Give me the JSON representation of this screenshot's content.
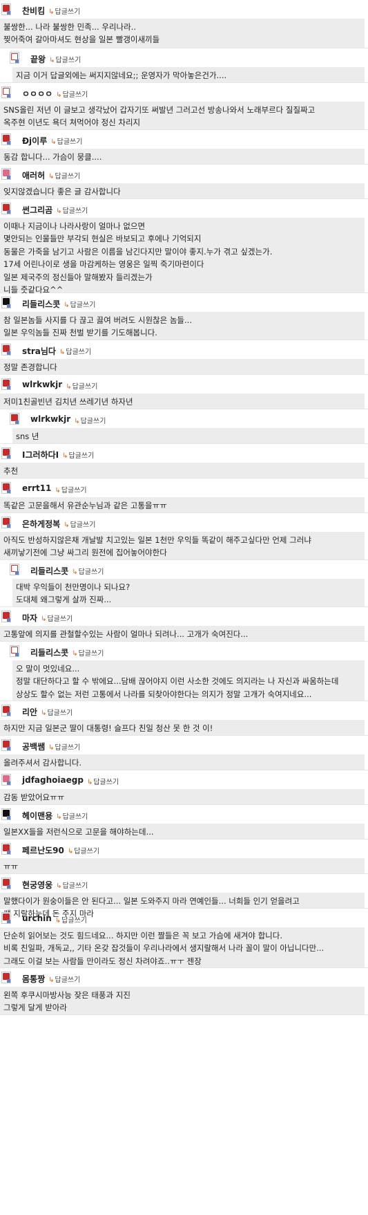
{
  "reply_label": "답글쓰기",
  "comments": [
    {
      "nick": "찬비킴",
      "avatar": "red",
      "nested": false,
      "body_height": 42,
      "lines": [
        "불쌍한... 나라 불쌍한 민족... 우리나라..",
        "찢어죽여 갈아마셔도 현상을 일본 빨갱이새끼들"
      ]
    },
    {
      "nick": "끝왕",
      "avatar": "plain",
      "nested": true,
      "body_height": 22,
      "lines": [
        "지금 이거 답글외에는 써지지않네요;; 운영자가 막아놓은건가...."
      ]
    },
    {
      "nick": "ㅇㅇㅇㅇ",
      "avatar": "plain",
      "nested": false,
      "body_height": 40,
      "lines": [
        "SNS올린 저년 이 글보고 생각났어 갑자기또 써발년 그러고선 방송나와서 노래부르다 질질짜고",
        "옥주현 이년도 욕더 쳐먹어야 정신 차리지"
      ]
    },
    {
      "nick": "Ðj이루",
      "avatar": "red",
      "nested": false,
      "body_height": 22,
      "lines": [
        "동감 합니다... 가슴이 뭉클...."
      ]
    },
    {
      "nick": "애러허",
      "avatar": "pink",
      "nested": false,
      "body_height": 22,
      "lines": [
        "잊지않겠습니다 좋은 글 감사합니다"
      ]
    },
    {
      "nick": "썬그리곰",
      "avatar": "red",
      "nested": false,
      "body_height": 108,
      "lines": [
        "이때나 지금이나 나라사랑이 얼마나 없으면",
        "몇안되는 인물들만 부각되 현실은 바보되고 후에나 기억되지",
        "동물은 가죽을 남기고 사람은 이름을 남긴다지만 말이야 좋지.누가 겪고 싶겠는가.",
        "17세 어린나이로 생을 마감케하는 영웅은 일찍 죽기마련이다",
        "일본 제국주의 정신들아 말해봤자 들리겠는가",
        "니들 줏같다요^^"
      ]
    },
    {
      "nick": "리들리스콧",
      "avatar": "black",
      "nested": false,
      "body_height": 40,
      "lines": [
        "참 일본놈들 사지를 다 끊고 끓여 버려도 시원찮은 놈들...",
        "일본 우익놈들 진짜 천벌 받기를 기도해봅니다."
      ]
    },
    {
      "nick": "stra님다",
      "avatar": "red",
      "nested": false,
      "body_height": 22,
      "lines": [
        "정말 존경합니다"
      ]
    },
    {
      "nick": "wlrkwkjr",
      "avatar": "red",
      "nested": false,
      "body_height": 22,
      "lines": [
        "저미1친골빈년 김치년 쓰레기년 하자년"
      ]
    },
    {
      "nick": "wlrkwkjr",
      "avatar": "red",
      "nested": true,
      "body_height": 22,
      "lines": [
        "sns 년"
      ]
    },
    {
      "nick": "I그러하다I",
      "avatar": "red",
      "nested": false,
      "body_height": 22,
      "lines": [
        "추천"
      ]
    },
    {
      "nick": "errt11",
      "avatar": "red",
      "nested": false,
      "body_height": 22,
      "lines": [
        "똑같은 고문을해서 유관순누님과 같은 고통을ㅠㅠ"
      ]
    },
    {
      "nick": "은하게정복",
      "avatar": "red",
      "nested": false,
      "body_height": 40,
      "lines": [
        "아직도 반성하지않은채 개날발 치고있는 일본 1천만 우익들 똑같이 해주고싶다만 언제 그러냐",
        "새끼낳기전에 그냥 싸그리 원전에 집어놓어야한다"
      ]
    },
    {
      "nick": "리들리스콧",
      "avatar": "plain",
      "nested": true,
      "body_height": 40,
      "lines": [
        "대박 우익들이 천만명이나 되나요?",
        "도대체 왜그렇게 살까 진짜..."
      ]
    },
    {
      "nick": "마자",
      "avatar": "red",
      "nested": false,
      "body_height": 22,
      "lines": [
        "고통앞에 의지를 관철할수있는 사람이 얼마나 되려나... 고개가 숙여진다..."
      ]
    },
    {
      "nick": "리들리스콧",
      "avatar": "plain",
      "nested": true,
      "body_height": 58,
      "lines": [
        "오 말이 멋있네요...",
        "정말 대단하다고 할 수 밖에요...담배 끊어야지 이런 사소한 것에도 의지라는 나 자신과 싸움하는데",
        "상상도 할수 없는 저런 고통에서 나라를 되찾아야한다는 의지가 정말 고개가 숙여지네요..."
      ]
    },
    {
      "nick": "리안",
      "avatar": "red",
      "nested": false,
      "body_height": 22,
      "lines": [
        "하지만 지금 일본군 딸이 대통령! 슬프다 친일 청산 못 한 것 이!"
      ]
    },
    {
      "nick": "공백쌤",
      "avatar": "red",
      "nested": false,
      "body_height": 22,
      "lines": [
        "올려주셔서 감사합니다."
      ]
    },
    {
      "nick": "jdfaghoiaegp",
      "avatar": "pink",
      "nested": false,
      "body_height": 22,
      "lines": [
        "감동 받았어요ㅠㅠ"
      ]
    },
    {
      "nick": "헤이맨용",
      "avatar": "black",
      "nested": false,
      "body_height": 22,
      "lines": [
        "일본XX들을 저런식으로 고문을 해야하는데..."
      ]
    },
    {
      "nick": "페르난도90",
      "avatar": "red",
      "nested": false,
      "body_height": 22,
      "lines": [
        "ㅠㅠ"
      ]
    },
    {
      "nick": "현궁영웅",
      "avatar": "red",
      "nested": false,
      "body_height": 22,
      "lines": [
        "말했다이가 원숭이들은 안 된다고... 일본 도와주지 마라 연예인들... 너희들 인기 얻을려고",
        "쌩 지랄하는데 돈 주지 마라"
      ]
    },
    {
      "nick": "urchin",
      "avatar": "red",
      "nested": false,
      "body_height": 58,
      "lines": [
        "단순히 읽어보는 것도 힘드네요... 하지만 이런 짤들은 꼭 보고 가슴에 새겨야 합니다.",
        "비록 친일파, 개독교,, 기타 온갖 잡것들이 우리나라에서 생지랄해서 나라 꼴이 말이 아닙니다만...",
        "그래도 이걸 보는 사람들 만이라도 정신 차려야죠..ㅠㅜ 젠장"
      ]
    },
    {
      "nick": "몸통짱",
      "avatar": "red",
      "nested": false,
      "body_height": 40,
      "lines": [
        "왼쪽 후쿠시마방사능 잦은 태풍과 지진",
        "그렇게 달게 받아라"
      ]
    }
  ]
}
